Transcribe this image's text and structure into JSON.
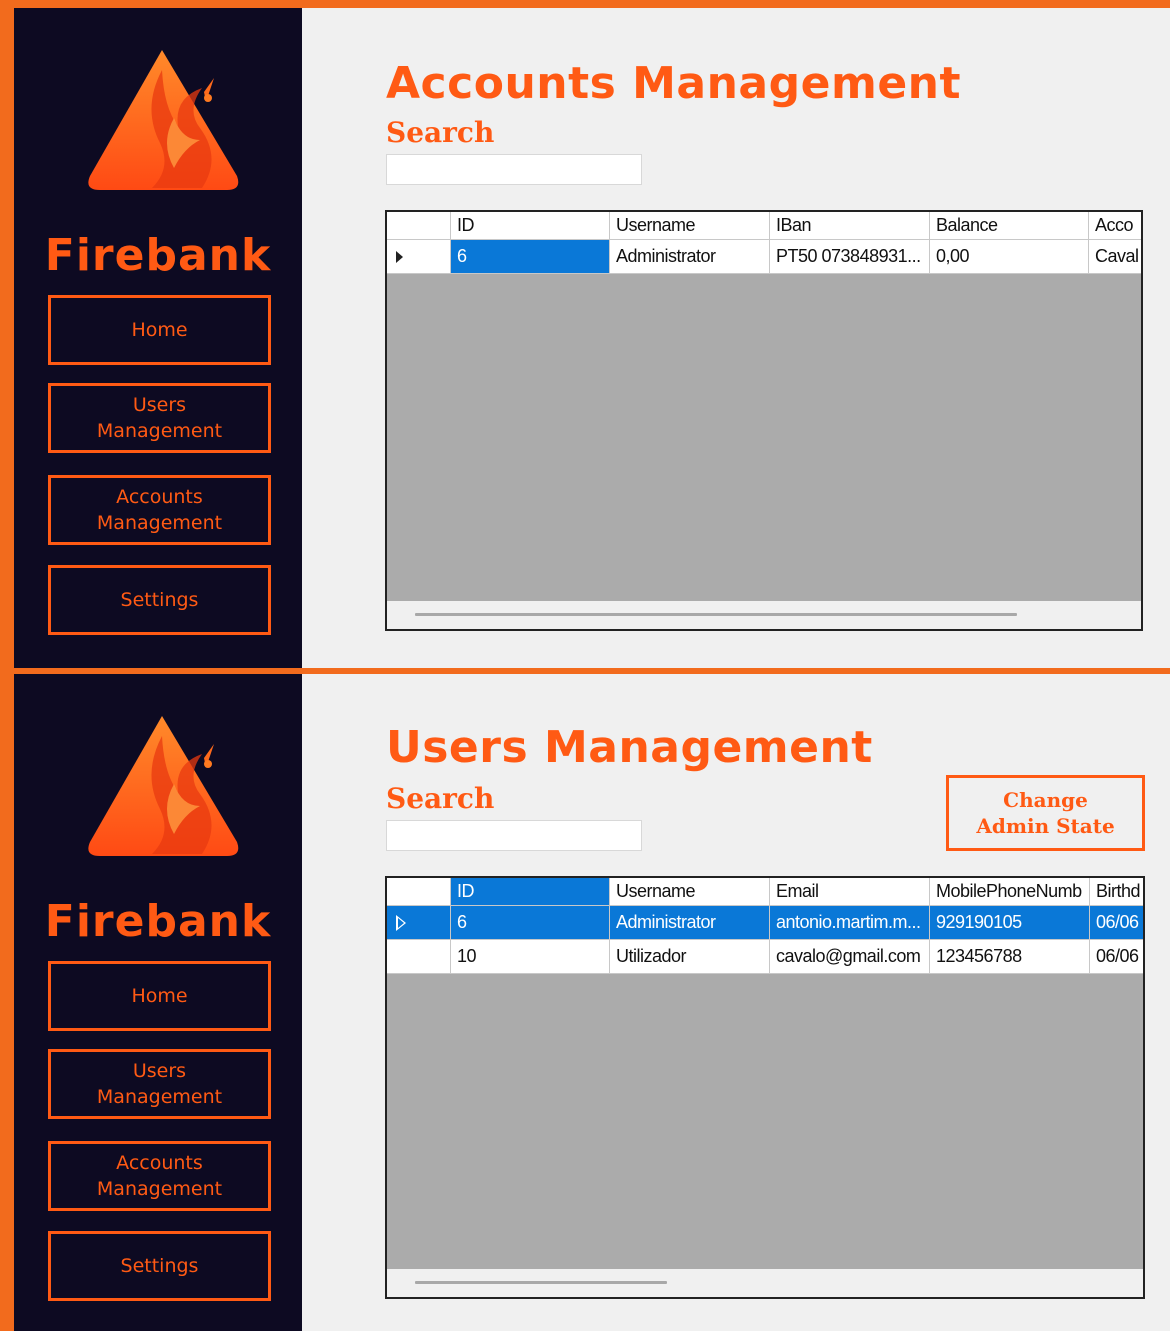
{
  "brand": {
    "name": "Firebank",
    "accent_color": "#ff5a14",
    "sidebar_color": "#0d0a22",
    "logo_icon": "flame-triangle-logo"
  },
  "nav": {
    "home": "Home",
    "users": "Users\nManagement",
    "accounts": "Accounts\nManagement",
    "settings": "Settings"
  },
  "accounts_view": {
    "title": "Accounts Management",
    "search_label": "Search",
    "search_value": "",
    "columns": [
      "ID",
      "Username",
      "IBan",
      "Balance",
      "Acco"
    ],
    "rows": [
      [
        "6",
        "Administrator",
        "PT50 073848931...",
        "0,00",
        "Caval"
      ]
    ],
    "selected_row": 0
  },
  "users_view": {
    "title": "Users Management",
    "search_label": "Search",
    "search_value": "",
    "change_admin_button": "Change\nAdmin State",
    "columns": [
      "ID",
      "Username",
      "Email",
      "MobilePhoneNumb",
      "Birthd"
    ],
    "rows": [
      [
        "6",
        "Administrator",
        "antonio.martim.m...",
        "929190105",
        "06/06"
      ],
      [
        "10",
        "Utilizador",
        "cavalo@gmail.com",
        "123456788",
        "06/06"
      ]
    ],
    "selected_row": 0
  }
}
